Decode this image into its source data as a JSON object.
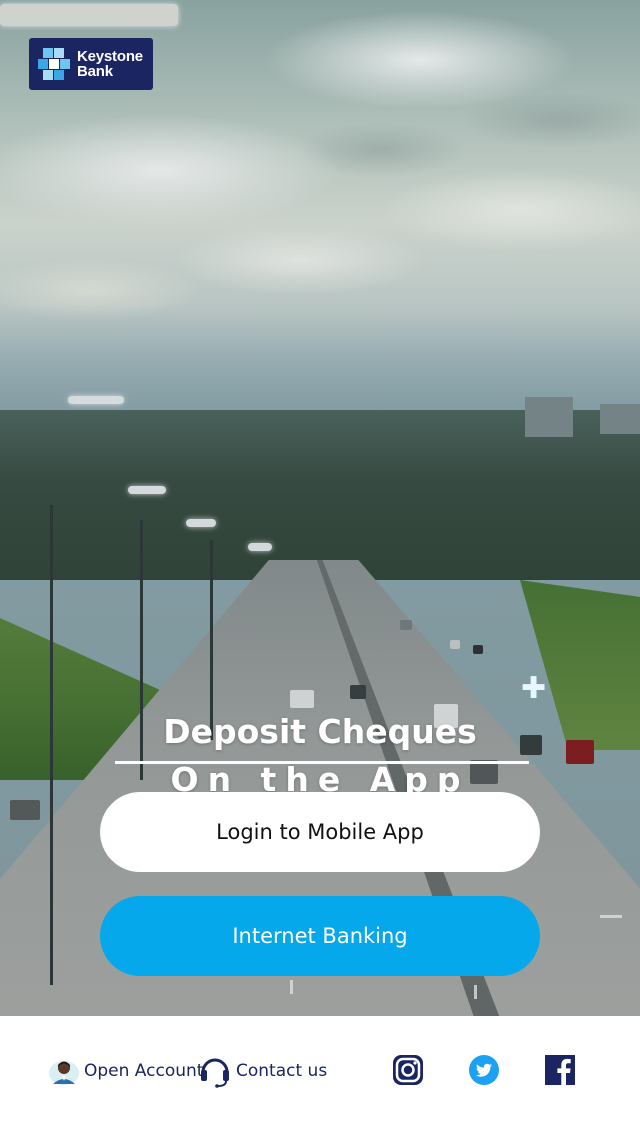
{
  "brand": {
    "name_line1": "Keystone",
    "name_line2": "Bank",
    "colors": {
      "navy": "#1b2561",
      "sky": "#05a8ea",
      "white": "#ffffff"
    }
  },
  "hero": {
    "headline": "Deposit Cheques",
    "subheadline": "On the App"
  },
  "actions": {
    "login_label": "Login to Mobile App",
    "internet_banking_label": "Internet Banking"
  },
  "footer": {
    "open_account_label": "Open Account",
    "contact_us_label": "Contact us",
    "icons": {
      "open_account": "person-avatar-icon",
      "contact_us": "headset-icon",
      "instagram": "instagram-icon",
      "twitter": "twitter-icon",
      "facebook": "facebook-icon"
    }
  }
}
